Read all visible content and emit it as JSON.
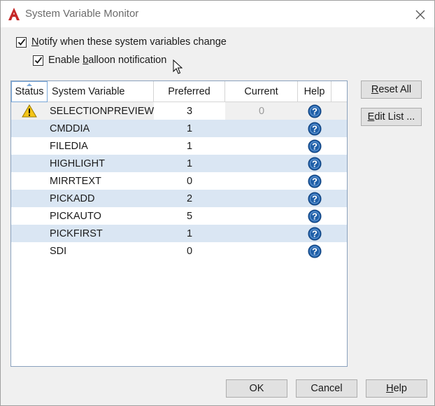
{
  "window": {
    "title": "System Variable Monitor"
  },
  "options": {
    "notify": {
      "prefix": "",
      "key": "N",
      "rest": "otify when these system variables change",
      "checked": true
    },
    "balloon": {
      "prefix": "Enable ",
      "key": "b",
      "rest": "alloon notification",
      "checked": true
    }
  },
  "table": {
    "columns": [
      "Status",
      "System Variable",
      "Preferred",
      "Current",
      "Help"
    ],
    "rows": [
      {
        "status_icon": "warning-icon",
        "name": "SELECTIONPREVIEW",
        "preferred": "3",
        "current": "0"
      },
      {
        "status_icon": "",
        "name": "CMDDIA",
        "preferred": "1",
        "current": ""
      },
      {
        "status_icon": "",
        "name": "FILEDIA",
        "preferred": "1",
        "current": ""
      },
      {
        "status_icon": "",
        "name": "HIGHLIGHT",
        "preferred": "1",
        "current": ""
      },
      {
        "status_icon": "",
        "name": "MIRRTEXT",
        "preferred": "0",
        "current": ""
      },
      {
        "status_icon": "",
        "name": "PICKADD",
        "preferred": "2",
        "current": ""
      },
      {
        "status_icon": "",
        "name": "PICKAUTO",
        "preferred": "5",
        "current": ""
      },
      {
        "status_icon": "",
        "name": "PICKFIRST",
        "preferred": "1",
        "current": ""
      },
      {
        "status_icon": "",
        "name": "SDI",
        "preferred": "0",
        "current": ""
      }
    ]
  },
  "buttons": {
    "reset_all": {
      "key": "R",
      "rest": "eset All"
    },
    "edit_list": {
      "key": "E",
      "rest": "dit List ..."
    },
    "ok": "OK",
    "cancel": "Cancel",
    "help": {
      "key": "H",
      "rest": "elp"
    }
  },
  "colors": {
    "row_alt": "#dae6f3",
    "help_icon": "#1f5fa8",
    "warning_icon": "#f5c518"
  }
}
